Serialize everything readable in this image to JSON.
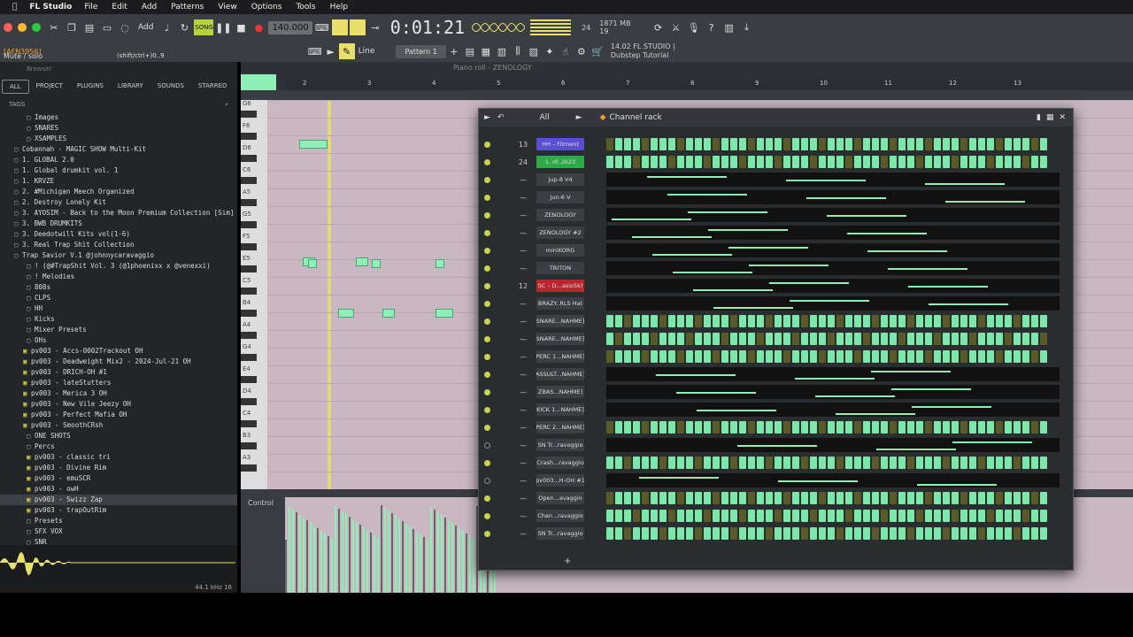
{
  "menubar": {
    "app": "FL Studio",
    "items": [
      "File",
      "Edit",
      "Add",
      "Patterns",
      "View",
      "Options",
      "Tools",
      "Help"
    ]
  },
  "toolbar": {
    "tempo": "140.000",
    "time": "0:01:21",
    "time_label": "M:S:CS",
    "cpu": "24",
    "mem": "1871 MB",
    "voices": "19",
    "pattern": "Pattern 1",
    "snap": "Line",
    "hint_left": "[AFN3956]",
    "hint_mute": "Mute / solo",
    "hint_keys": "(shift/ctrl+)0..9",
    "version": "14.02",
    "fl_label": "FL STUDIO |",
    "project": "Dubstep Tutorial"
  },
  "browser": {
    "title": "Browser",
    "tabs": [
      "ALL",
      "PROJECT",
      "PLUGINS",
      "LIBRARY",
      "SOUNDS",
      "STARRED"
    ],
    "tags": "TAGS",
    "items": [
      "Images",
      "SNARES",
      "XSAMPLES",
      "Cobannah - MAGIC SHOW Multi-Kit",
      "1. GLOBAL 2.0",
      "1. Global drumkit vol. 1",
      "1. KRVZE",
      "2. #Michigan Meech Organized",
      "2. Destroy Lonely Kit",
      "3. AYOSIM - Back to the Moon Premium Collection [Sim]",
      "3. BWB DRUMKITS",
      "3. Deedotwill Kits vol(1-6)",
      "3. Real Trap Shit Collection",
      "Trap Savior V.1 @johnnycaravaggio",
      "! (@#TrapShit Vol. 3 (@1phoenixx x @venexxi)",
      "! Melodies",
      "808s",
      "CLPS",
      "HH",
      "Kicks",
      "Mixer Presets",
      "OHs",
      "pv003 - Accs-0002Trackout OH",
      "pv003 - Deadweight Mix2 - 2024-Jul-21 OH",
      "pv003 - DRICH-OH #1",
      "pv003 - lateStutters",
      "pv003 - Merica 3 OH",
      "pv003 - New Vile Jeezy OH",
      "pv003 - Perfect Mafia OH",
      "pv003 - SmoothCRsh",
      "ONE SHOTS",
      "Percs",
      "pv003 - classic tri",
      "pv003 - Divine Rim",
      "pv003 - emuSCR",
      "pv003 - owH",
      "pv003 - Swizz Zap",
      "pv003 - trapOutRim",
      "Presets",
      "SFX VOX",
      "SNR"
    ],
    "sample_rate": "44.1 kHz 16"
  },
  "pianoroll": {
    "title": "Piano roll - ZENOLOGY",
    "ruler": [
      "2",
      "3",
      "4",
      "5",
      "6",
      "7",
      "8",
      "9",
      "10",
      "11",
      "12",
      "13"
    ],
    "keys": [
      "G6",
      "F6",
      "D6",
      "C6",
      "A5",
      "G5",
      "F5",
      "E5",
      "C5",
      "B4",
      "A4",
      "G4",
      "E4",
      "D4",
      "C4",
      "B3",
      "A3"
    ],
    "control": "Control"
  },
  "channelrack": {
    "title": "Channel rack",
    "filter": "All",
    "channels": [
      {
        "num": "13",
        "name": "HH – Fitment",
        "type": "pads",
        "color": "#5a4fd0"
      },
      {
        "num": "24",
        "name": "1. of..2k23",
        "type": "pads",
        "color": "#2fa84a"
      },
      {
        "num": "",
        "name": "Jup-8 V4",
        "type": "roll",
        "color": ""
      },
      {
        "num": "",
        "name": "Jun-6 V",
        "type": "roll",
        "color": ""
      },
      {
        "num": "",
        "name": "ZENOLOGY",
        "type": "roll",
        "color": ""
      },
      {
        "num": "",
        "name": "ZENOLOGY #2",
        "type": "roll",
        "color": ""
      },
      {
        "num": "",
        "name": "miniKORG",
        "type": "roll",
        "color": ""
      },
      {
        "num": "",
        "name": "TRITON",
        "type": "roll",
        "color": ""
      },
      {
        "num": "12",
        "name": "SC – D...asio5k)",
        "type": "roll",
        "color": "#b8262e"
      },
      {
        "num": "",
        "name": "BRAZY..RLS Hat",
        "type": "roll",
        "color": ""
      },
      {
        "num": "",
        "name": "SNARE...NAHME]",
        "type": "pads",
        "color": ""
      },
      {
        "num": "",
        "name": "SNARE...NAHME]",
        "type": "pads",
        "color": ""
      },
      {
        "num": "",
        "name": "PERC 1...NAHME]",
        "type": "pads",
        "color": ""
      },
      {
        "num": "",
        "name": "ASSULT...NAHME]",
        "type": "roll",
        "color": ""
      },
      {
        "num": "",
        "name": "ZBAS...NAHME]",
        "type": "roll",
        "color": ""
      },
      {
        "num": "",
        "name": "KICK 1...NAHME]",
        "type": "roll",
        "color": ""
      },
      {
        "num": "",
        "name": "PERC 2...NAHME]",
        "type": "pads",
        "color": ""
      },
      {
        "num": "",
        "name": "SN Tr...ravaggio",
        "type": "roll",
        "color": ""
      },
      {
        "num": "",
        "name": "Crash...ravaggio",
        "type": "pads",
        "color": ""
      },
      {
        "num": "",
        "name": "pv003...H-OH #1",
        "type": "roll",
        "color": ""
      },
      {
        "num": "",
        "name": "Open...avaggio",
        "type": "pads",
        "color": ""
      },
      {
        "num": "",
        "name": "Chan...ravaggio",
        "type": "pads",
        "color": ""
      },
      {
        "num": "",
        "name": "SN Tr...ravaggio",
        "type": "pads",
        "color": ""
      }
    ]
  },
  "colors": {
    "accent": "#8ef0b6",
    "pad_off": "#5a5a28",
    "pad_on": "#7ae8a8",
    "yellow": "#e8e06a"
  }
}
